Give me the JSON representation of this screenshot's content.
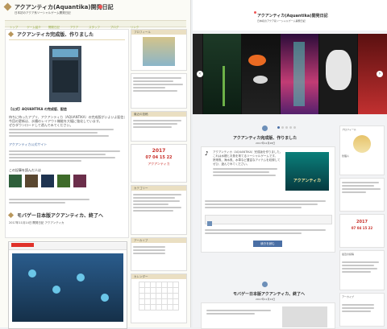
{
  "left": {
    "site_title": "アクアンティカ(Aquantika)開発日記",
    "site_sub": "日本初のアクア系ソーシャルゲーム開発日記",
    "nav": [
      "トップ",
      "ゲーム紹介",
      "開発日記",
      "アクア",
      "スタッフ",
      "ブログ",
      "リンク"
    ],
    "post1_title": "アクアンティカ完成版、作りました",
    "post1_caption": "【公式】AQUANTIKA の完成版、配信",
    "post1_lines": [
      "待ちに待ったアプリ、アクアンティカ（AQUANTIKA）の完成版がいよいよ配信されました。",
      "今回の更新は、水槽のレイアウト機能を大幅に強化しています。",
      "ぜひダウンロードして遊んでみてください。"
    ],
    "post1_link": "アクアンティカ公式サイト",
    "related_label": "この記事を読んだ人は",
    "post2_title": "モバゲー日本版アクアンティカ、終了へ",
    "post2_meta": "2017年11月14日 開発日記 アクアンティカ",
    "sidebar_heads": [
      "プロフィール",
      "最近の投稿",
      "カテゴリー",
      "アーカイブ",
      "カレンダー"
    ],
    "counter_year": "2017",
    "counter_date": "07 04 15 22",
    "counter_text": "アクアンティカ"
  },
  "right": {
    "site_title": "アクアンティカ(Aquantika)開発日記",
    "site_sub": "日本初のアクア系ソーシャルゲーム開発日記",
    "post1_title": "アクアンティカ完成版、作りました",
    "post1_date": "2017年12月28日",
    "post1_lines": [
      "アクアンティカ（AQUANTIKA）完成版を作りました。",
      "これは水槽とお魚を育てるソーシャルゲームです。",
      "熱帯魚、海水魚、水草など豊富なアイテムを収録しています。",
      "ぜひ、遊んでみてください。"
    ],
    "logo_text": "アクアンティカ",
    "more_button": "続きを読む",
    "post2_title": "モバゲー日本版アクアンティカ、終了へ",
    "post2_date": "2017年11月14日",
    "profile_name": "管理人",
    "counter_year": "2017",
    "counter_date": "07 04 15 22",
    "side_heads": [
      "プロフィール",
      "最近の投稿",
      "アーカイブ"
    ]
  },
  "colors": {
    "accent_gold": "#b8975c",
    "nav_green": "#9ab04a",
    "link_blue": "#4a6fa5",
    "counter_red": "#c8302a"
  }
}
